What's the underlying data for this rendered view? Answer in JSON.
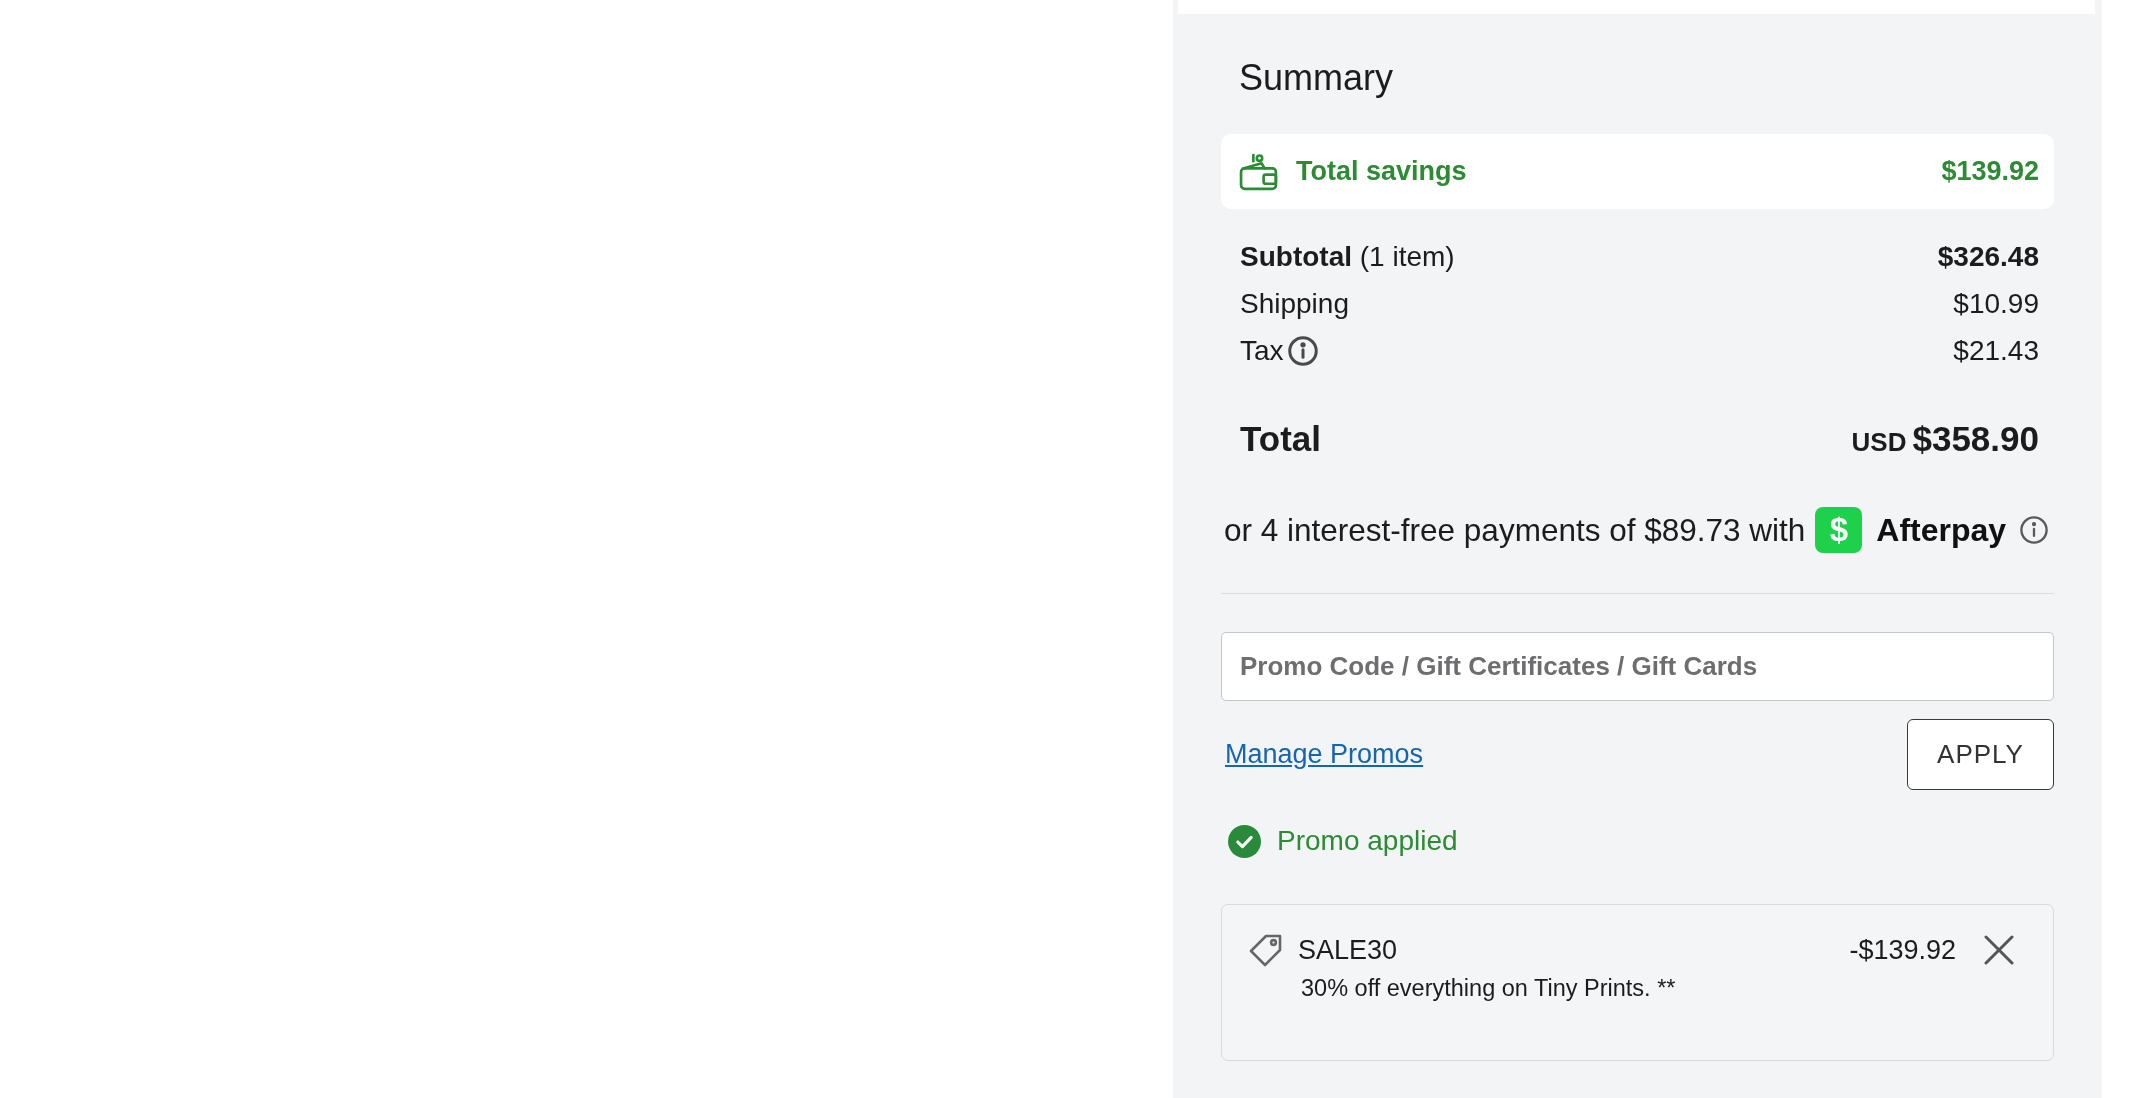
{
  "summary": {
    "title": "Summary"
  },
  "savings": {
    "label": "Total savings",
    "amount": "$139.92"
  },
  "lines": [
    {
      "kind": "bold",
      "label": "**Subtotal** (1 item)",
      "amount": "$326.48"
    },
    {
      "kind": "plain",
      "label": "Shipping",
      "amount": "$10.99"
    },
    {
      "kind": "info",
      "label": "Tax",
      "amount": "$21.43"
    }
  ],
  "total": {
    "label": "Total",
    "currency": "USD",
    "amount": "$358.90"
  },
  "afterpay": {
    "text": "or 4 interest-free payments of $89.73 with",
    "logo_mark": "$",
    "brand": "Afterpay"
  },
  "promo_field": {
    "placeholder": "Promo Code / Gift Certificates / Gift Cards"
  },
  "manage_link": "Manage Promos",
  "apply_button": "APPLY",
  "promo_status": "Promo applied",
  "applied_promos": [
    {
      "code": "SALE30",
      "amount": "-$139.92",
      "description": "30% off everything on Tiny Prints. **"
    }
  ]
}
